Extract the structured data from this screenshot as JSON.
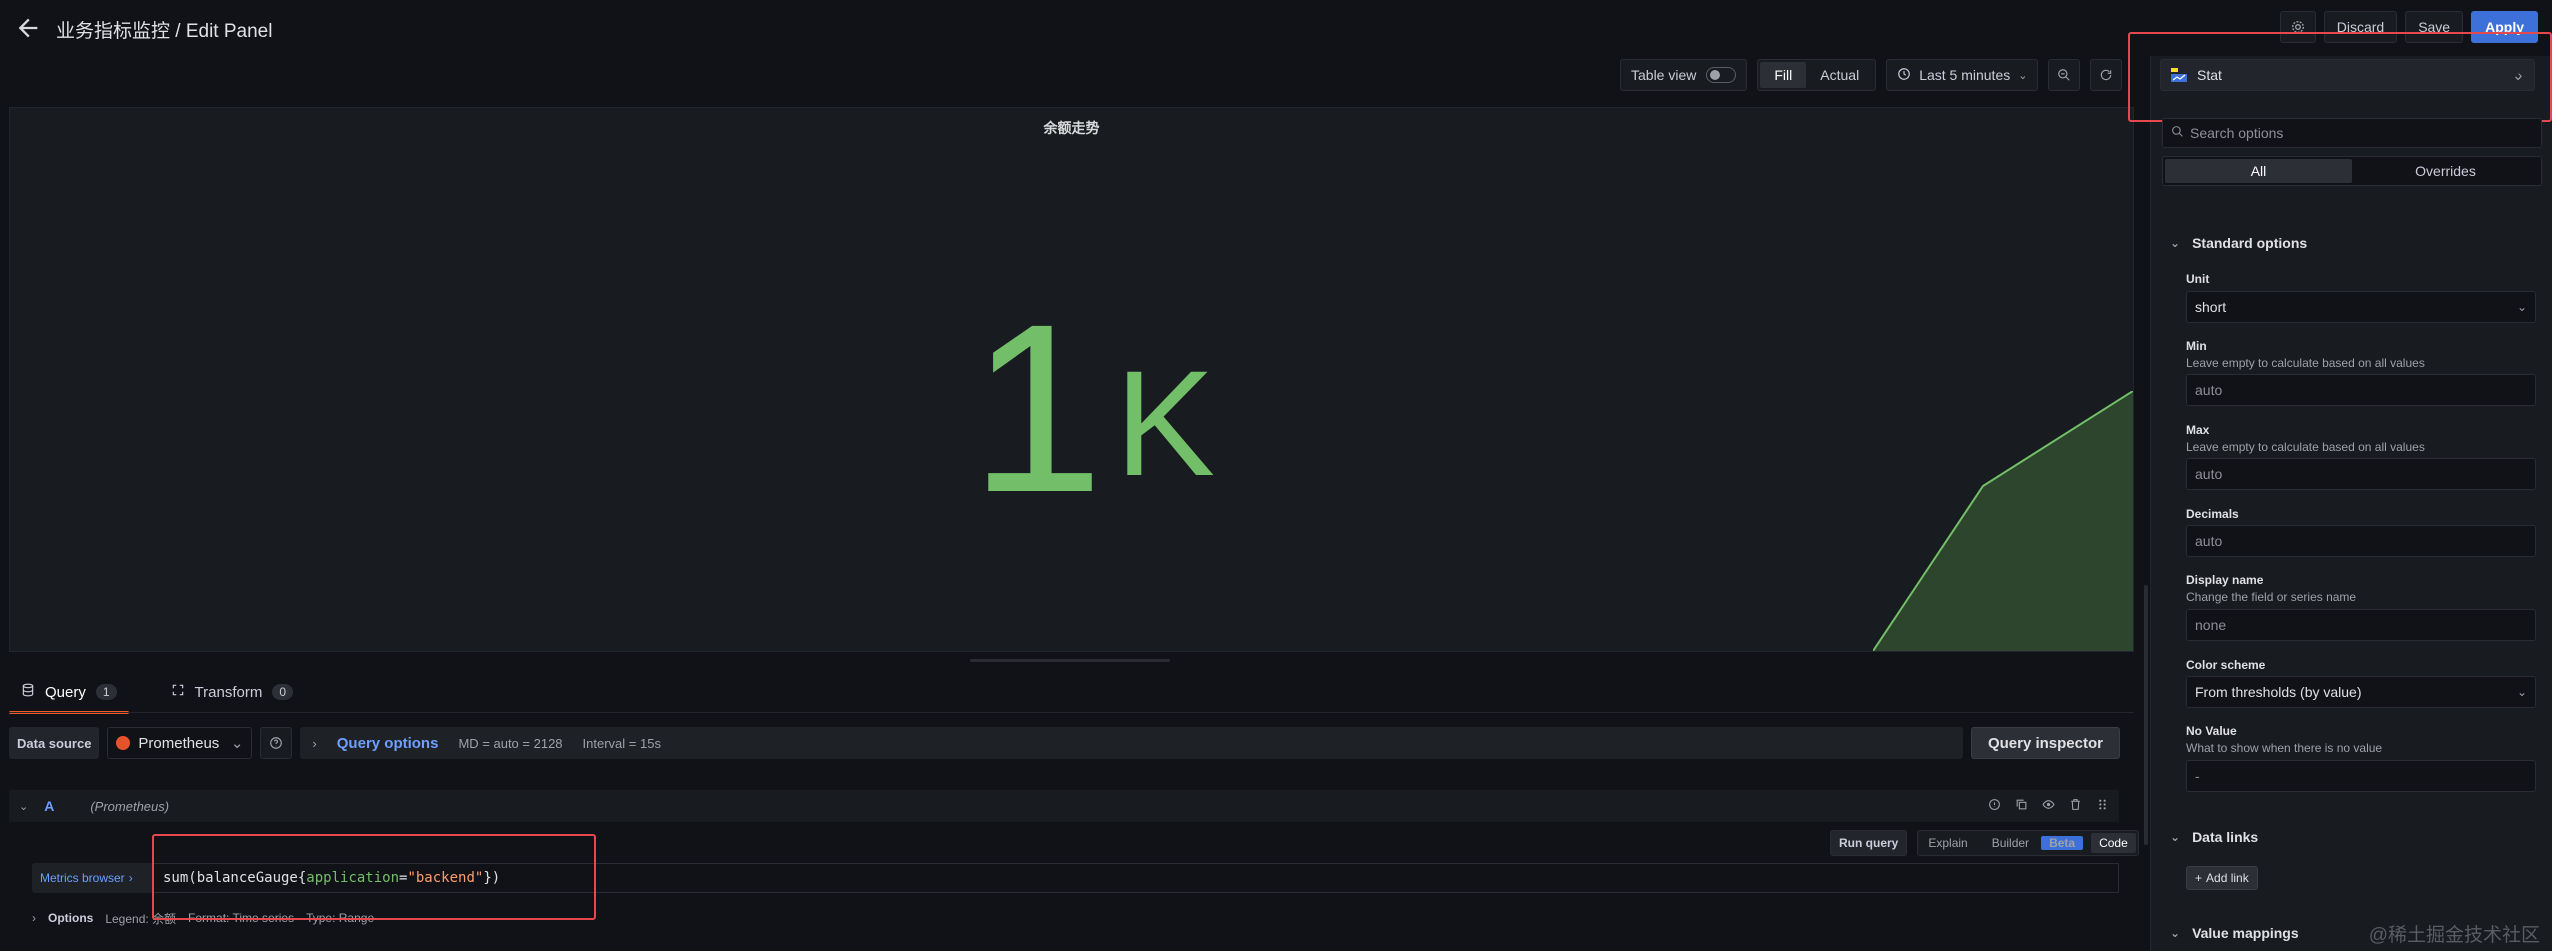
{
  "header": {
    "title": "业务指标监控 / Edit Panel",
    "discard_label": "Discard",
    "save_label": "Save",
    "apply_label": "Apply"
  },
  "toolbar": {
    "table_view_label": "Table view",
    "fill_label": "Fill",
    "actual_label": "Actual",
    "time_range": "Last 5 minutes"
  },
  "panel": {
    "title": "余额走势",
    "stat_value": "1",
    "stat_unit": "K",
    "value_color": "#73bf69"
  },
  "query_tabs": [
    {
      "label": "Query",
      "count": "1"
    },
    {
      "label": "Transform",
      "count": "0"
    }
  ],
  "datasource": {
    "label": "Data source",
    "name": "Prometheus",
    "query_options_label": "Query options",
    "md": "MD = auto = 2128",
    "interval": "Interval = 15s",
    "query_inspector_label": "Query inspector"
  },
  "query": {
    "ref": "A",
    "ds": "(Prometheus)",
    "run_label": "Run query",
    "modes": [
      "Explain",
      "Builder",
      "Code"
    ],
    "beta_label": "Beta",
    "metrics_browser": "Metrics browser",
    "expr_fn": "sum(balanceGauge{",
    "expr_label": "application",
    "expr_eq": "=",
    "expr_str": "\"backend\"",
    "expr_end": "})",
    "options_title": "Options",
    "legend": "Legend: 余额",
    "format": "Format: Time series",
    "type": "Type: Range"
  },
  "options": {
    "viz": "Stat",
    "search_placeholder": "Search options",
    "tab_all": "All",
    "tab_overrides": "Overrides",
    "standard_title": "Standard options",
    "unit_label": "Unit",
    "unit_value": "short",
    "min_label": "Min",
    "min_desc": "Leave empty to calculate based on all values",
    "min_placeholder": "auto",
    "max_label": "Max",
    "max_desc": "Leave empty to calculate based on all values",
    "max_placeholder": "auto",
    "decimals_label": "Decimals",
    "decimals_placeholder": "auto",
    "display_name_label": "Display name",
    "display_name_desc": "Change the field or series name",
    "display_name_placeholder": "none",
    "color_scheme_label": "Color scheme",
    "color_scheme_value": "From thresholds (by value)",
    "no_value_label": "No Value",
    "no_value_desc": "What to show when there is no value",
    "no_value_placeholder": "-",
    "data_links_title": "Data links",
    "add_link_label": "Add link",
    "value_mappings_title": "Value mappings"
  },
  "watermark": "@稀土掘金技术社区"
}
